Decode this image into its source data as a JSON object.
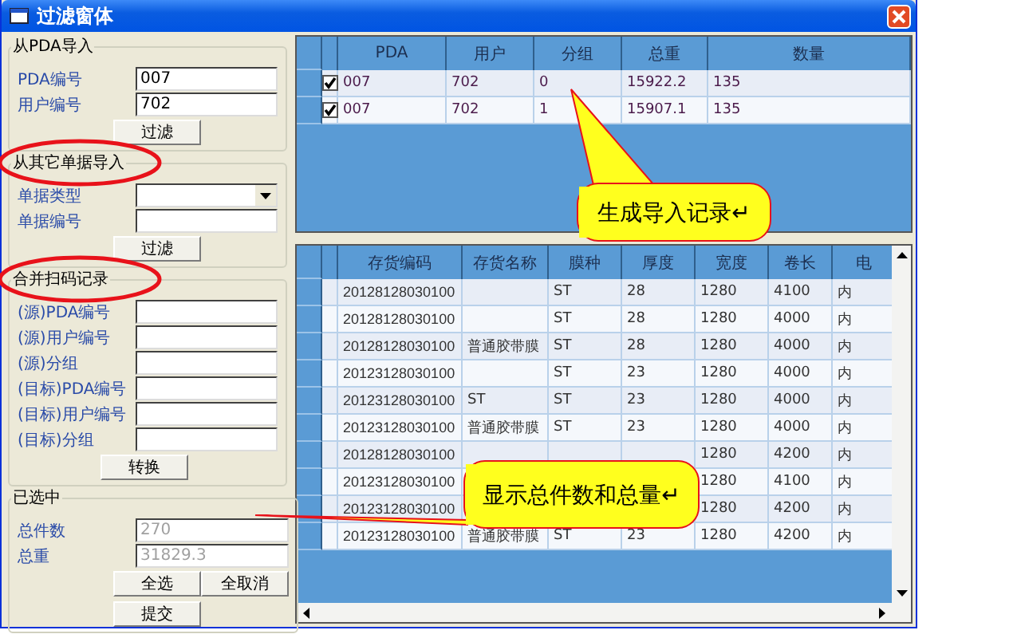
{
  "window": {
    "title": "过滤窗体"
  },
  "from_pda": {
    "title": "从PDA导入",
    "button": "过滤",
    "fields": [
      {
        "kind": "text",
        "label": "PDA编号",
        "value": "007"
      },
      {
        "kind": "text",
        "label": "用户编号",
        "value": "702"
      }
    ]
  },
  "from_other": {
    "title": "从其它单据导入",
    "button": "过滤",
    "fields": [
      {
        "kind": "dropdown",
        "label": "单据类型"
      },
      {
        "kind": "text",
        "label": "单据编号"
      }
    ]
  },
  "merge": {
    "title": "合并扫码记录",
    "button": "转换",
    "fields": [
      {
        "kind": "text",
        "label": "(源)PDA编号"
      },
      {
        "kind": "text",
        "label": "(源)用户编号"
      },
      {
        "kind": "text",
        "label": "(源)分组"
      },
      {
        "kind": "text",
        "label": "(目标)PDA编号"
      },
      {
        "kind": "text",
        "label": "(目标)用户编号"
      },
      {
        "kind": "text",
        "label": "(目标)分组"
      }
    ]
  },
  "selected": {
    "title": "已选中",
    "buttons": [
      "全选",
      "全取消",
      "提交"
    ],
    "fields": [
      {
        "label": "总件数",
        "value": "270",
        "disabled": true
      },
      {
        "label": "总重",
        "value": "31829.3",
        "disabled": true
      }
    ]
  },
  "import_grid": {
    "columns": [
      "PDA",
      "用户",
      "分组",
      "总重",
      "数量"
    ],
    "rows": [
      {
        "checked": true,
        "cells": [
          "007",
          "702",
          "0",
          "15922.2",
          "135"
        ]
      },
      {
        "checked": true,
        "cells": [
          "007",
          "702",
          "1",
          "15907.1",
          "135"
        ]
      }
    ]
  },
  "detail_grid": {
    "columns": [
      "存货编码",
      "存货名称",
      "膜种",
      "厚度",
      "宽度",
      "卷长",
      "电"
    ],
    "rows": [
      [
        "20128128030100",
        null,
        "ST",
        "28",
        "1280",
        "4100",
        "内"
      ],
      [
        "20128128030100",
        null,
        "ST",
        "28",
        "1280",
        "4000",
        "内"
      ],
      [
        "20128128030100",
        "普通胶带膜",
        "ST",
        "28",
        "1280",
        "4000",
        "内"
      ],
      [
        "20123128030100",
        null,
        "ST",
        "23",
        "1280",
        "4000",
        "内"
      ],
      [
        "20123128030100",
        "ST",
        "ST",
        "23",
        "1280",
        "4000",
        "内"
      ],
      [
        "20123128030100",
        "普通胶带膜",
        "ST",
        "23",
        "1280",
        "4000",
        "内"
      ],
      [
        "20128128030100",
        null,
        null,
        null,
        "1280",
        "4200",
        "内"
      ],
      [
        "20123128030100",
        null,
        null,
        null,
        "1280",
        "4100",
        "内"
      ],
      [
        "20123128030100",
        null,
        null,
        null,
        "1280",
        "4200",
        "内"
      ],
      [
        "20123128030100",
        "普通胶带膜",
        "ST",
        "23",
        "1280",
        "4200",
        "内"
      ]
    ]
  },
  "annotations": [
    {
      "kind": "callout",
      "text": "生成导入记录↵"
    },
    {
      "kind": "callout",
      "text": "显示总件数和总量↵"
    }
  ]
}
